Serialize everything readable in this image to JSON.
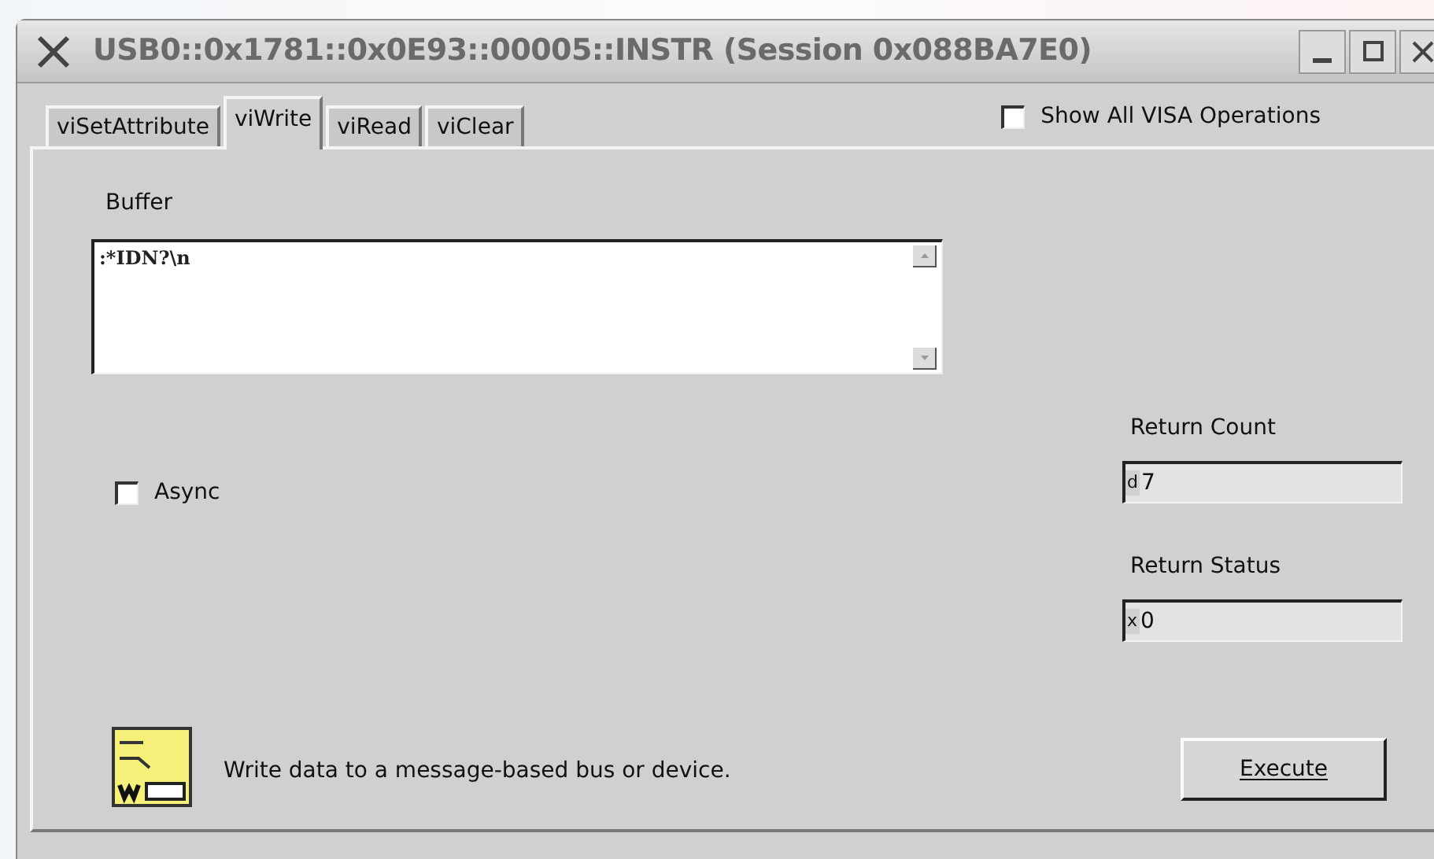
{
  "window": {
    "title": "USB0::0x1781::0x0E93::00005::INSTR (Session 0x088BA7E0)"
  },
  "tabs": [
    {
      "label": "viSetAttribute",
      "selected": false
    },
    {
      "label": "viWrite",
      "selected": true
    },
    {
      "label": "viRead",
      "selected": false
    },
    {
      "label": "viClear",
      "selected": false
    }
  ],
  "show_all": {
    "label": "Show All VISA Operations",
    "checked": false
  },
  "buffer": {
    "label": "Buffer",
    "value": ":*IDN?\\n"
  },
  "async": {
    "label": "Async",
    "checked": false
  },
  "return_count": {
    "label": "Return Count",
    "radix": "d",
    "value": "7"
  },
  "return_status": {
    "label": "Return Status",
    "radix": "x",
    "value": "0"
  },
  "description": "Write data to a message-based bus or device.",
  "execute": {
    "label": "Execute"
  }
}
